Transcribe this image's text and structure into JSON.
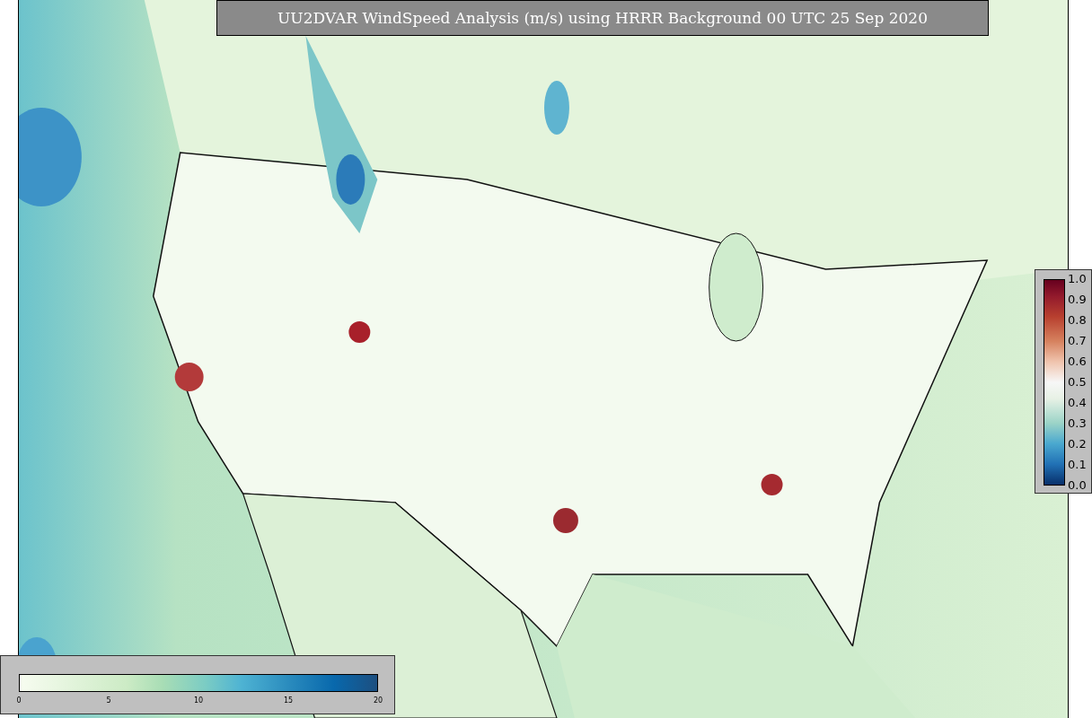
{
  "title": "UU2DVAR WindSpeed Analysis (m/s) using HRRR Background 00 UTC 25 Sep 2020",
  "error_colorbar": {
    "ticks": [
      "1.0",
      "0.9",
      "0.8",
      "0.7",
      "0.6",
      "0.5",
      "0.4",
      "0.3",
      "0.2",
      "0.1",
      "0.0"
    ]
  },
  "speed_colorbar": {
    "ticks": [
      "0",
      "5",
      "10",
      "15",
      "20"
    ]
  }
}
